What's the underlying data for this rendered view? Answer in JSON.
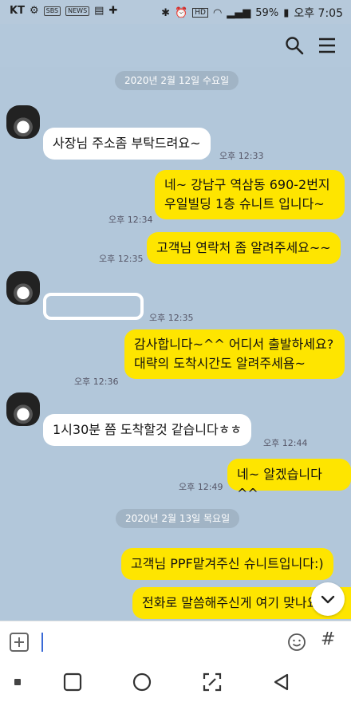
{
  "statusbar": {
    "carrier": "KT",
    "small_icons": [
      "SBS",
      "NEWS"
    ],
    "battery": "59%",
    "time": "오후 7:05"
  },
  "chat": {
    "dates": [
      "2020년 2월 12일 수요일",
      "2020년 2월 13일 목요일"
    ],
    "messages": [
      {
        "dir": "in",
        "text": "사장님 주소좀 부탁드려요~",
        "time": "오후 12:33"
      },
      {
        "dir": "out",
        "text": "네~ 강남구 역삼동 690-2번지\n우일빌딩 1층 슈니트 입니다~",
        "time": "오후 12:34"
      },
      {
        "dir": "out",
        "text": "고객님 연락처 좀 알려주세요~~",
        "time": "오후 12:35"
      },
      {
        "dir": "in",
        "text": "",
        "time": "오후 12:35"
      },
      {
        "dir": "out",
        "text": "감사합니다~^^ 어디서  출발하세요?\n대략의 도착시간도 알려주세욤~",
        "time": "오후 12:36"
      },
      {
        "dir": "in",
        "text": "1시30분 쯤 도착할것 같습니다ㅎㅎ",
        "time": "오후 12:44"
      },
      {
        "dir": "out",
        "text": "네~ 알겠습니다^^",
        "time": "오후 12:49"
      },
      {
        "dir": "out",
        "text": "고객님 PPF맡겨주신 슈니트입니다:)",
        "time": ""
      },
      {
        "dir": "out",
        "text": "전화로 말씀해주신게 여기 맞나요",
        "time": ""
      }
    ]
  },
  "input": {
    "placeholder": ""
  },
  "icons": {
    "search": "search-icon",
    "menu": "menu-icon",
    "plus": "plus-icon",
    "emoji": "emoji-icon",
    "hash": "#",
    "scroll": "chevron-down-icon"
  }
}
